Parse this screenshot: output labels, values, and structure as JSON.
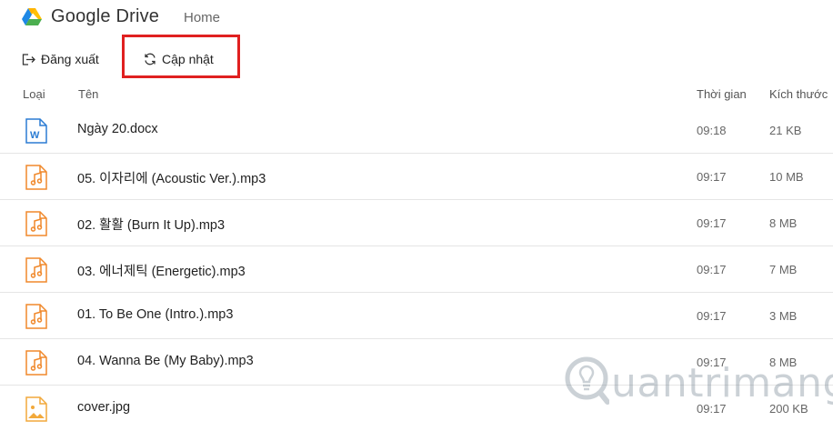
{
  "app": {
    "title": "Google Drive",
    "nav_home": "Home"
  },
  "actions": {
    "logout_label": "Đăng xuất",
    "refresh_label": "Cập nhật"
  },
  "table": {
    "headers": {
      "type": "Loại",
      "name": "Tên",
      "time": "Thời gian",
      "size": "Kích thước"
    },
    "rows": [
      {
        "icon": "word-doc-icon",
        "name": "Ngày 20.docx",
        "time": "09:18",
        "size": "21 KB"
      },
      {
        "icon": "music-file-icon",
        "name": "05. 이자리에 (Acoustic Ver.).mp3",
        "time": "09:17",
        "size": "10 MB"
      },
      {
        "icon": "music-file-icon",
        "name": "02. 활활 (Burn It Up).mp3",
        "time": "09:17",
        "size": "8 MB"
      },
      {
        "icon": "music-file-icon",
        "name": "03. 에너제틱 (Energetic).mp3",
        "time": "09:17",
        "size": "7 MB"
      },
      {
        "icon": "music-file-icon",
        "name": "01. To Be One (Intro.).mp3",
        "time": "09:17",
        "size": "3 MB"
      },
      {
        "icon": "music-file-icon",
        "name": "04. Wanna Be (My Baby).mp3",
        "time": "09:17",
        "size": "8 MB"
      },
      {
        "icon": "image-file-icon",
        "name": "cover.jpg",
        "time": "09:17",
        "size": "200 KB"
      }
    ]
  },
  "watermark": {
    "text": "uantrimang"
  },
  "colors": {
    "highlight": "#e02020",
    "audio_icon": "#f0892c",
    "word_icon": "#2b7cd3",
    "image_icon": "#f2a93b"
  }
}
